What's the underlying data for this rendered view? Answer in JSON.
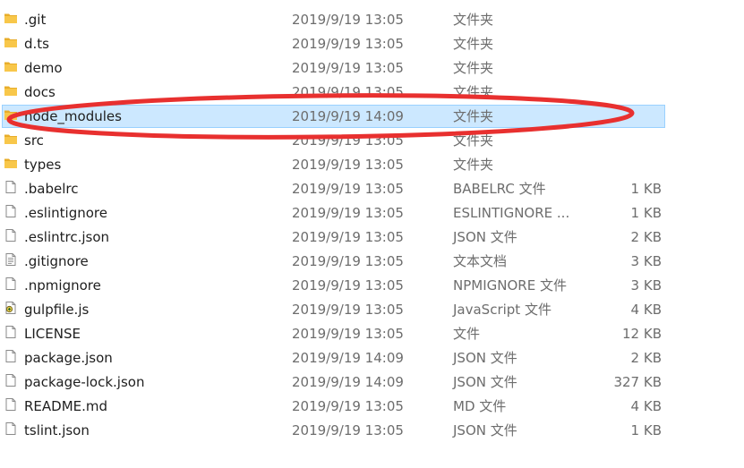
{
  "files": [
    {
      "name": ".git",
      "date": "2019/9/19 13:05",
      "type": "文件夹",
      "size": "",
      "icon": "folder-icon"
    },
    {
      "name": "d.ts",
      "date": "2019/9/19 13:05",
      "type": "文件夹",
      "size": "",
      "icon": "folder-icon"
    },
    {
      "name": "demo",
      "date": "2019/9/19 13:05",
      "type": "文件夹",
      "size": "",
      "icon": "folder-icon"
    },
    {
      "name": "docs",
      "date": "2019/9/19 13:05",
      "type": "文件夹",
      "size": "",
      "icon": "folder-icon"
    },
    {
      "name": "node_modules",
      "date": "2019/9/19 14:09",
      "type": "文件夹",
      "size": "",
      "icon": "folder-icon",
      "selected": true
    },
    {
      "name": "src",
      "date": "2019/9/19 13:05",
      "type": "文件夹",
      "size": "",
      "icon": "folder-icon"
    },
    {
      "name": "types",
      "date": "2019/9/19 13:05",
      "type": "文件夹",
      "size": "",
      "icon": "folder-icon"
    },
    {
      "name": ".babelrc",
      "date": "2019/9/19 13:05",
      "type": "BABELRC 文件",
      "size": "1 KB",
      "icon": "file-icon"
    },
    {
      "name": ".eslintignore",
      "date": "2019/9/19 13:05",
      "type": "ESLINTIGNORE ...",
      "size": "1 KB",
      "icon": "file-icon"
    },
    {
      "name": ".eslintrc.json",
      "date": "2019/9/19 13:05",
      "type": "JSON 文件",
      "size": "2 KB",
      "icon": "file-icon"
    },
    {
      "name": ".gitignore",
      "date": "2019/9/19 13:05",
      "type": "文本文档",
      "size": "3 KB",
      "icon": "text-file-icon"
    },
    {
      "name": ".npmignore",
      "date": "2019/9/19 13:05",
      "type": "NPMIGNORE 文件",
      "size": "3 KB",
      "icon": "file-icon"
    },
    {
      "name": "gulpfile.js",
      "date": "2019/9/19 13:05",
      "type": "JavaScript 文件",
      "size": "4 KB",
      "icon": "script-file-icon"
    },
    {
      "name": "LICENSE",
      "date": "2019/9/19 13:05",
      "type": "文件",
      "size": "12 KB",
      "icon": "file-icon"
    },
    {
      "name": "package.json",
      "date": "2019/9/19 14:09",
      "type": "JSON 文件",
      "size": "2 KB",
      "icon": "file-icon"
    },
    {
      "name": "package-lock.json",
      "date": "2019/9/19 14:09",
      "type": "JSON 文件",
      "size": "327 KB",
      "icon": "file-icon"
    },
    {
      "name": "README.md",
      "date": "2019/9/19 13:05",
      "type": "MD 文件",
      "size": "4 KB",
      "icon": "file-icon"
    },
    {
      "name": "tslint.json",
      "date": "2019/9/19 13:05",
      "type": "JSON 文件",
      "size": "1 KB",
      "icon": "file-icon"
    }
  ],
  "colors": {
    "selection_bg": "#cce8ff",
    "selection_border": "#99d1ff",
    "annotation": "#e8302f",
    "folder": "#f8c74a"
  }
}
